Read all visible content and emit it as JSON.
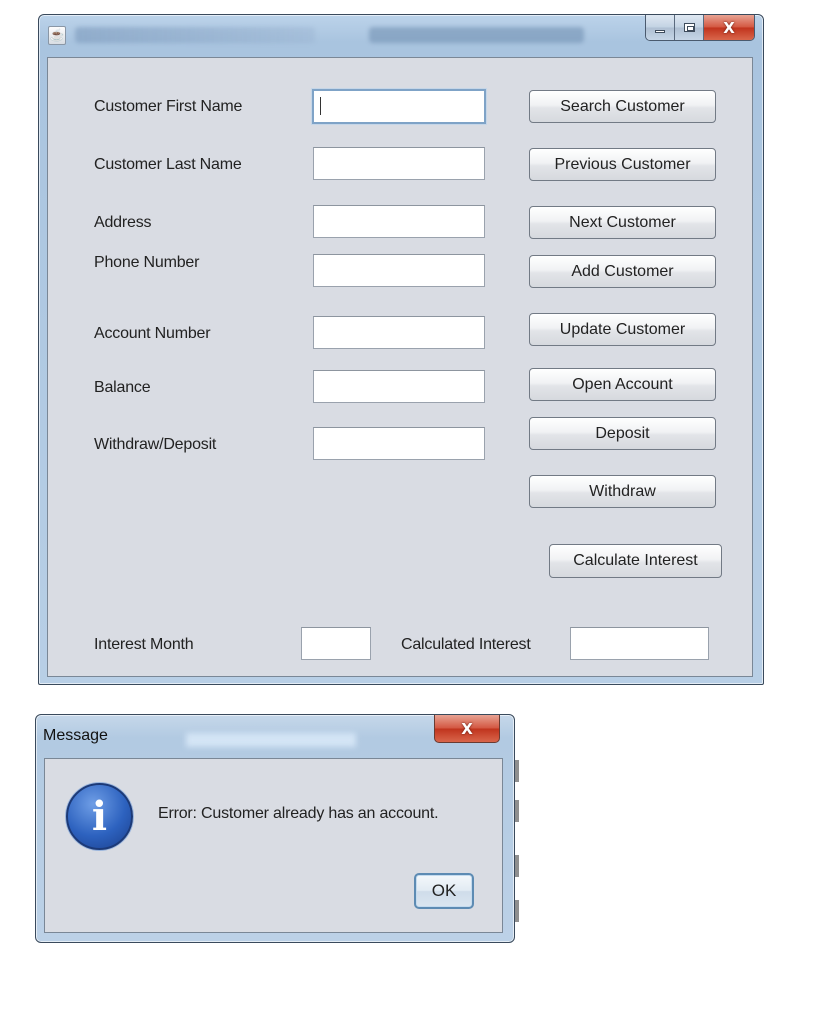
{
  "window": {
    "title": "[blurred title]",
    "controls": {
      "minimize": "minimize",
      "maximize": "maximize",
      "close": "close"
    }
  },
  "form": {
    "fields": [
      {
        "label": "Customer First Name",
        "value": "",
        "focused": true
      },
      {
        "label": "Customer Last Name",
        "value": ""
      },
      {
        "label": "Address",
        "value": ""
      },
      {
        "label": "Phone Number",
        "value": ""
      },
      {
        "label": "Account Number",
        "value": ""
      },
      {
        "label": "Balance",
        "value": ""
      },
      {
        "label": "Withdraw/Deposit",
        "value": ""
      }
    ],
    "buttons": {
      "search": "Search Customer",
      "previous": "Previous Customer",
      "next": "Next Customer",
      "add": "Add Customer",
      "update": "Update Customer",
      "open_account": "Open Account",
      "deposit": "Deposit",
      "withdraw": "Withdraw",
      "calculate_interest": "Calculate Interest"
    },
    "interest": {
      "month_label": "Interest Month",
      "month_value": "",
      "calculated_label": "Calculated Interest",
      "calculated_value": ""
    }
  },
  "dialog": {
    "title": "Message",
    "icon": "info-icon",
    "icon_glyph": "i",
    "message": "Error: Customer already has an account.",
    "ok_label": "OK",
    "close_glyph": "X"
  },
  "glyphs": {
    "close": "X",
    "app_icon": "☕"
  },
  "colors": {
    "client_bg": "#d9dce3",
    "title_bar": "#b8cfe6",
    "close_red": "#c0331d",
    "info_blue": "#2d62bf"
  }
}
